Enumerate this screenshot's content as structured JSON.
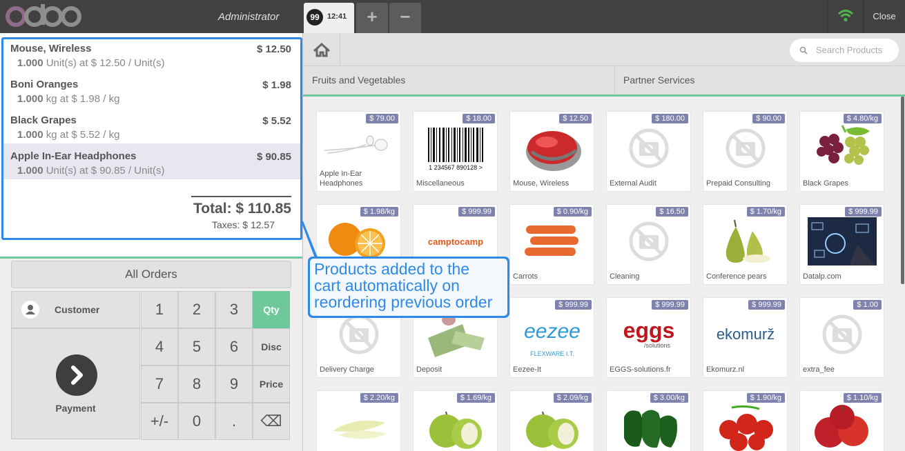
{
  "header": {
    "user": "Administrator",
    "order_number": "99",
    "order_time": "12:41",
    "add_label": "+",
    "remove_label": "−",
    "close_label": "Close"
  },
  "order": {
    "lines": [
      {
        "name": "Mouse, Wireless",
        "price": "$ 12.50",
        "qty": "1.000",
        "unit_info": "Unit(s) at $ 12.50 / Unit(s)"
      },
      {
        "name": "Boni Oranges",
        "price": "$ 1.98",
        "qty": "1.000",
        "unit_info": "kg at $ 1.98 / kg"
      },
      {
        "name": "Black Grapes",
        "price": "$ 5.52",
        "qty": "1.000",
        "unit_info": "kg at $ 5.52 / kg"
      },
      {
        "name": "Apple In-Ear Headphones",
        "price": "$ 90.85",
        "qty": "1.000",
        "unit_info": "Unit(s) at $ 90.85 / Unit(s)"
      }
    ],
    "total": "Total: $ 110.85",
    "taxes": "Taxes: $ 12.57"
  },
  "actions": {
    "all_orders": "All Orders",
    "customer": "Customer",
    "payment": "Payment"
  },
  "numpad": {
    "keys": [
      "1",
      "2",
      "3",
      "Qty",
      "4",
      "5",
      "6",
      "Disc",
      "7",
      "8",
      "9",
      "Price",
      "+/-",
      "0",
      ".",
      "⌫"
    ],
    "active_mode": "Qty"
  },
  "search": {
    "placeholder": "Search Products"
  },
  "categories": [
    "Fruits and Vegetables",
    "Partner Services"
  ],
  "products": [
    {
      "name": "Apple In-Ear Headphones",
      "price": "$ 79.00",
      "icon": "earphones"
    },
    {
      "name": "Miscellaneous",
      "price": "$ 18.00",
      "icon": "barcode"
    },
    {
      "name": "Mouse, Wireless",
      "price": "$ 12.50",
      "icon": "mouse"
    },
    {
      "name": "External Audit",
      "price": "$ 180.00",
      "icon": "no-image"
    },
    {
      "name": "Prepaid Consulting",
      "price": "$ 90.00",
      "icon": "no-image"
    },
    {
      "name": "Black Grapes",
      "price": "$ 4.80/kg",
      "icon": "grapes"
    },
    {
      "name": "",
      "price": "$ 1.98/kg",
      "icon": "oranges"
    },
    {
      "name": "",
      "price": "$ 999.99",
      "icon": "camptocamp-logo",
      "logo_text": "camptocamp"
    },
    {
      "name": "Carrots",
      "price": "$ 0.90/kg",
      "icon": "carrots"
    },
    {
      "name": "Cleaning",
      "price": "$ 16.50",
      "icon": "no-image"
    },
    {
      "name": "Conference pears",
      "price": "$ 1.70/kg",
      "icon": "pears"
    },
    {
      "name": "Datalp.com",
      "price": "$ 999.99",
      "icon": "datalp"
    },
    {
      "name": "Delivery Charge",
      "price": "",
      "icon": "no-image"
    },
    {
      "name": "Deposit",
      "price": "",
      "icon": "money"
    },
    {
      "name": "Eezee-It",
      "price": "$ 999.99",
      "icon": "eezee-logo",
      "logo_text": "eezee",
      "logo_sub": "FLEXWARE I.T."
    },
    {
      "name": "EGGS-solutions.fr",
      "price": "$ 999.99",
      "icon": "eggs-logo",
      "logo_text": "eggs",
      "logo_sub": "/solutions"
    },
    {
      "name": "Ekomurz.nl",
      "price": "$ 999.99",
      "icon": "ekomurz-logo",
      "logo_text": "ekomurž"
    },
    {
      "name": "extra_fee",
      "price": "$ 1.00",
      "icon": "no-image"
    },
    {
      "name": "",
      "price": "$ 2.20/kg",
      "icon": "endive"
    },
    {
      "name": "",
      "price": "$ 1.69/kg",
      "icon": "green-apples"
    },
    {
      "name": "",
      "price": "$ 2.09/kg",
      "icon": "green-apples"
    },
    {
      "name": "",
      "price": "$ 3.00/kg",
      "icon": "green-peppers"
    },
    {
      "name": "",
      "price": "$ 1.90/kg",
      "icon": "tomatoes"
    },
    {
      "name": "",
      "price": "$ 1.10/kg",
      "icon": "red-apples"
    }
  ],
  "callout": {
    "lines": [
      "Products added to the",
      "cart automatically on",
      "reordering previous order"
    ]
  },
  "colors": {
    "accent": "#6ec89b",
    "price_badge": "#7f82ac",
    "callout": "#2d8ae8",
    "topbar": "#414141",
    "logo": "#875a7b"
  }
}
